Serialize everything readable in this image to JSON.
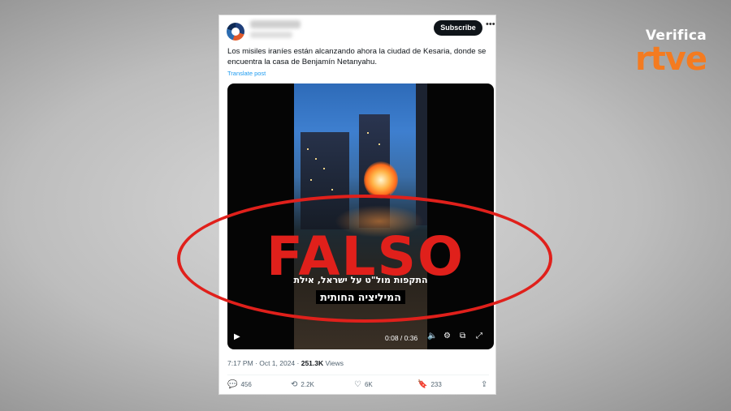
{
  "brand": {
    "top": "Verifica",
    "bottom": "rtve",
    "accent": "#f47b20"
  },
  "post": {
    "subscribe_label": "Subscribe",
    "more_icon": "more-dots-icon",
    "text": "Los misiles iraníes están alcanzando ahora la ciudad de Kesaria, donde se encuentra la casa de Benjamín Netanyahu.",
    "translate_label": "Translate post",
    "video": {
      "subtitle_line1": "התקפות מול\"ט על ישראל, אילת",
      "subtitle_line2": "המיליציה החותית",
      "time": "0:08 / 0:36"
    },
    "timestamp": "7:17 PM · Oct 1, 2024 · ",
    "views_count": "251.3K",
    "views_label": " Views",
    "replies": "456",
    "reposts": "2.2K",
    "likes": "6K",
    "bookmarks": "233"
  },
  "stamp": {
    "text": "FALSO",
    "color": "#e0201b"
  }
}
